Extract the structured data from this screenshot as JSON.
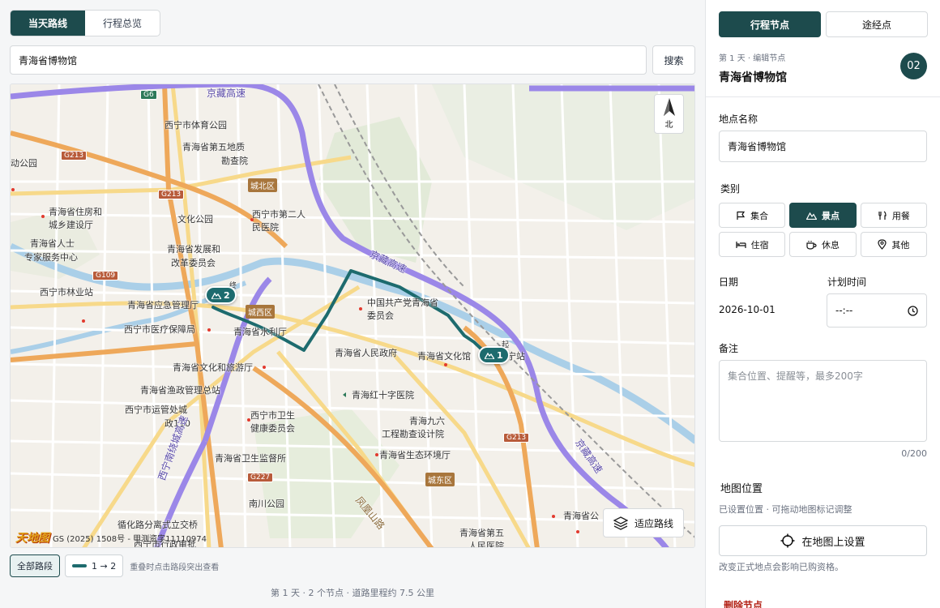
{
  "left": {
    "tabs": [
      {
        "label": "当天路线",
        "active": true
      },
      {
        "label": "行程总览",
        "active": false
      }
    ],
    "search": {
      "value": "青海省博物馆",
      "button_label": "搜索"
    },
    "map": {
      "compass_label": "北",
      "fit_button_label": "适应路线",
      "attribution": "GS (2025) 1508号 - 甲测资字11110974",
      "logo": "天地图",
      "markers": [
        {
          "label": "2",
          "icon": "mountain-icon"
        },
        {
          "label": "1",
          "icon": "mountain-icon"
        }
      ],
      "labels": {
        "l1": "西宁市体育公园",
        "l2": "青海省第五地质",
        "l3": "勘查院",
        "l4": "动公园",
        "l5": "青海省住房和",
        "l6": "城乡建设厅",
        "l7": "文化公园",
        "l8": "西宁市第二人",
        "l9": "民医院",
        "l10": "青海省人士",
        "l11": "专家服务中心",
        "l12": "青海省发展和",
        "l13": "改革委员会",
        "l14": "西宁市林业站",
        "l15": "青海省应急管理厅",
        "l16": "中国共产党青海省",
        "l17": "委员会",
        "l18": "西宁市医疗保障局",
        "l19": "青海省水利厅",
        "l20": "青海省人民政府",
        "l21": "青海省文化馆",
        "l22": "宁站",
        "l23": "青海省文化和旅游厅",
        "l24": "青海红十字医院",
        "l25": "青海省渔政管理总站",
        "l26": "西宁市运管处城",
        "l27": "政110",
        "l28": "西宁市卫生",
        "l29": "健康委员会",
        "l30": "青海九六",
        "l31": "工程勘查设计院",
        "l32": "青海省生态环境厅",
        "l33": "青海省卫生监督所",
        "l34": "南川公园",
        "l35": "循化路分离式立交桥",
        "l36": "西宁市行政审批",
        "l37": "青海省公",
        "l38": "青海省第五",
        "l39": "人民医院",
        "l40": "起",
        "l41": "终"
      },
      "districts": {
        "d1": "城北区",
        "d2": "城西区",
        "d3": "城东区"
      },
      "shields": {
        "s1": "G6",
        "s2": "G213",
        "s3": "G213",
        "s4": "G109",
        "s5": "G227",
        "s6": "G213"
      },
      "highways": {
        "h1": "京藏高速",
        "h2": "京藏高速",
        "h3": "京藏高速",
        "h4": "西宁南绕城高速",
        "h5": "凤凰山路"
      }
    },
    "legend": {
      "all_segments": "全部路段",
      "segment_label": "1 → 2",
      "hint": "重叠时点击路段突出查看"
    },
    "summary": "第 1 天 · 2 个节点 · 道路里程约 7.5 公里"
  },
  "right": {
    "tabs": [
      {
        "label": "行程节点",
        "active": true
      },
      {
        "label": "途经点",
        "active": false
      }
    ],
    "crumb": "第 1 天 · 编辑节点",
    "title": "青海省博物馆",
    "badge": "02",
    "name_label": "地点名称",
    "name_value": "青海省博物馆",
    "category_label": "类别",
    "categories": [
      {
        "label": "集合",
        "icon": "flag-icon",
        "active": false
      },
      {
        "label": "景点",
        "icon": "mountain-icon",
        "active": true
      },
      {
        "label": "用餐",
        "icon": "utensils-icon",
        "active": false
      },
      {
        "label": "住宿",
        "icon": "bed-icon",
        "active": false
      },
      {
        "label": "休息",
        "icon": "coffee-icon",
        "active": false
      },
      {
        "label": "其他",
        "icon": "pin-icon",
        "active": false
      }
    ],
    "date_label": "日期",
    "date_value": "2026-10-01",
    "time_label": "计划时间",
    "time_value": "--:--",
    "notes_label": "备注",
    "notes_placeholder": "集合位置、提醒等，最多200字",
    "notes_counter": "0/200",
    "map_pos_label": "地图位置",
    "map_pos_sub": "已设置位置 · 可拖动地图标记调整",
    "set_on_map_label": "在地图上设置",
    "warning": "改变正式地点会影响已购资格。",
    "delete_label": "删除节点"
  },
  "colors": {
    "accent": "#1d4b4d",
    "route": "#1d6b6e",
    "danger": "#b42318"
  }
}
